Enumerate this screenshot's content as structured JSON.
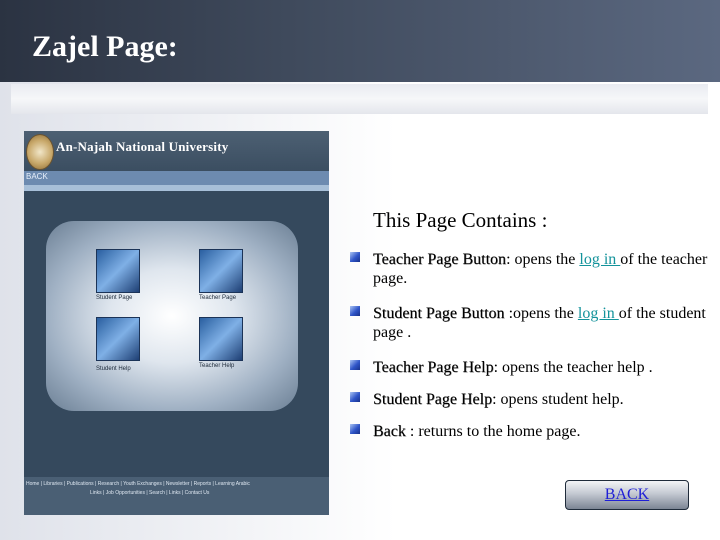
{
  "slide": {
    "title": "Zajel Page:"
  },
  "screenshot": {
    "university_name": "An-Najah National University",
    "back_link": "BACK",
    "tiles": [
      {
        "label": "Student Page",
        "icon": "student-page-icon"
      },
      {
        "label": "Teacher Page",
        "icon": "teacher-page-icon"
      },
      {
        "label": "Student Help",
        "icon": "student-help-icon"
      },
      {
        "label": "Teacher Help",
        "icon": "teacher-help-icon"
      }
    ],
    "footer_row1": "Home | Libraries | Publications | Research | Youth Exchanges | Newsletter | Reports | Learning Arabic",
    "footer_row2": "Links | Job Opportunities | Search | Links | Contact Us"
  },
  "content": {
    "heading": "This Page Contains :",
    "bullets": [
      {
        "term": "Teacher Page Button",
        "before_link": ": opens the ",
        "link": "log in ",
        "after_link": "of the teacher page."
      },
      {
        "term": "Student Page  Button",
        "before_link": " :opens the ",
        "link": "log in ",
        "after_link": "of the student page ."
      },
      {
        "term": "Teacher Page Help",
        "before_link": ": opens the teacher help .",
        "link": "",
        "after_link": ""
      },
      {
        "term": "Student Page Help",
        "before_link": ": opens student help.",
        "link": "",
        "after_link": ""
      },
      {
        "term": "Back",
        "before_link": " : returns to the home page.",
        "link": "",
        "after_link": ""
      }
    ]
  },
  "back_button": {
    "label": "BACK"
  },
  "colors": {
    "link": "#13939b",
    "back_link": "#1f1fd6",
    "bullet": "#2f55c8"
  }
}
